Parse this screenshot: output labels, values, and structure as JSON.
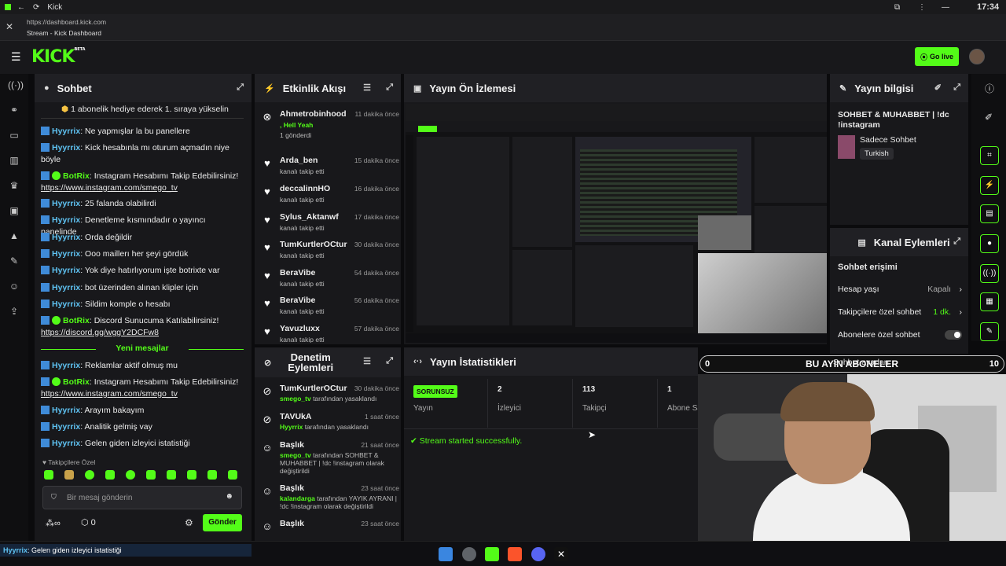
{
  "browser": {
    "tab_title": "Kick",
    "url": "https://dashboard.kick.com",
    "page_title": "Stream - Kick Dashboard",
    "clock": "17:34"
  },
  "app": {
    "logo": "KICK",
    "logo_tag": "BETA",
    "go_live": "Go live"
  },
  "chat": {
    "title": "Sohbet",
    "top_notice": "1 abonelik hediye ederek 1. sıraya yükselin",
    "messages": [
      {
        "user": "Hyyrrix",
        "text": "Ne yapmışlar la bu panellere"
      },
      {
        "user": "Hyyrrix",
        "text": "Kick hesabınla mı oturum açmadın niye böyle"
      },
      {
        "user": "BotRix",
        "text": "Instagram Hesabımı Takip Edebilirsiniz!",
        "link": "https://www.instagram.com/smego_tv"
      },
      {
        "user": "Hyyrrix",
        "text": "25 falanda olabilirdi"
      },
      {
        "user": "Hyyrrix",
        "text": "Denetleme kısmındadır o yayıncı panelinde"
      },
      {
        "user": "Hyyrrix",
        "text": "Orda değildir"
      },
      {
        "user": "Hyyrrix",
        "text": "Ooo maillerı her şeyi gördük"
      },
      {
        "user": "Hyyrrix",
        "text": "Yok diye hatırlıyorum işte botrixte var"
      },
      {
        "user": "Hyyrrix",
        "text": "bot üzerinden alınan klipler için"
      },
      {
        "user": "Hyyrrix",
        "text": "Sildim komple o hesabı"
      },
      {
        "user": "BotRix",
        "text": "Discord Sunucuma Katılabilirsiniz!",
        "link": "https://discord.gg/wggY2DCFw8"
      }
    ],
    "new_messages": "Yeni mesajlar",
    "messages2": [
      {
        "user": "Hyyrrix",
        "text": "Reklamlar aktif olmuş mu"
      },
      {
        "user": "BotRix",
        "text": "Instagram Hesabımı Takip Edebilirsiniz!",
        "link": "https://www.instagram.com/smego_tv"
      },
      {
        "user": "Hyyrrix",
        "text": "Arayım bakayım"
      },
      {
        "user": "Hyyrrix",
        "text": "Analitik gelmiş vay"
      },
      {
        "user": "Hyyrrix",
        "text": "Gelen giden izleyici istatistiği"
      }
    ],
    "followers_only": "Takipçilere Özel",
    "input_placeholder": "Bir mesaj gönderin",
    "count": "0",
    "send": "Gönder"
  },
  "activity": {
    "title": "Etkinlik Akışı",
    "items": [
      {
        "name": "Ahmetrobinhood",
        "extra": ", Hell Yeah",
        "sub": "1 gönderdi",
        "time": "11 dakika önce",
        "icon": "gift"
      },
      {
        "name": "Arda_ben",
        "sub": "kanalı takip etti",
        "time": "15 dakika önce",
        "icon": "heart"
      },
      {
        "name": "deccalinnHO",
        "sub": "kanalı takip etti",
        "time": "16 dakika önce",
        "icon": "heart"
      },
      {
        "name": "Sylus_Aktanwf",
        "sub": "kanalı takip etti",
        "time": "17 dakika önce",
        "icon": "heart"
      },
      {
        "name": "TumKurtlerOCtur",
        "sub": "kanalı takip etti",
        "time": "30 dakika önce",
        "icon": "heart"
      },
      {
        "name": "BeraVibe",
        "sub": "kanalı takip etti",
        "time": "54 dakika önce",
        "icon": "heart"
      },
      {
        "name": "BeraVibe",
        "sub": "kanalı takip etti",
        "time": "56 dakika önce",
        "icon": "heart"
      },
      {
        "name": "Yavuzluxx",
        "sub": "kanalı takip etti",
        "time": "57 dakika önce",
        "icon": "heart"
      }
    ]
  },
  "moderation": {
    "title": "Denetim Eylemleri",
    "items": [
      {
        "name": "TumKurtlerOCtur",
        "actor": "smego_tv",
        "text": "tarafından yasaklandı",
        "time": "30 dakika önce"
      },
      {
        "name": "TAVUkA",
        "actor": "Hyyrrix",
        "text": "tarafından yasaklandı",
        "time": "1 saat önce"
      },
      {
        "name": "Başlık",
        "actor": "smego_tv",
        "text": "tarafından SOHBET & MUHABBET | !dc !instagram olarak değiştirildi",
        "time": "21 saat önce"
      },
      {
        "name": "Başlık",
        "actor": "kalandarga",
        "text": "tarafından YAYIK AYRANI | !dc !instagram olarak değiştirildi",
        "time": "23 saat önce"
      },
      {
        "name": "Başlık",
        "actor": "",
        "text": "",
        "time": "23 saat önce"
      }
    ]
  },
  "preview": {
    "title": "Yayın Ön İzlemesi"
  },
  "stats": {
    "title": "Yayın İstatistikleri",
    "status": "SORUNSUZ",
    "status_label": "Yayın",
    "viewers": "2",
    "viewers_label": "İzleyici",
    "followers": "113",
    "followers_label": "Takipçi",
    "subs": "1",
    "subs_label": "Abone Sa",
    "message": "Stream started successfully."
  },
  "stream_info": {
    "title": "Yayın bilgisi",
    "stream_title": "SOHBET & MUHABBET | !dc !instagram",
    "category": "Sadece Sohbet",
    "language": "Turkish"
  },
  "channel_actions": {
    "title": "Kanal Eylemleri",
    "section": "Sohbet erişimi",
    "rows": [
      {
        "label": "Hesap yaşı",
        "value": "Kapalı"
      },
      {
        "label": "Takipçilere özel sohbet",
        "value": "1 dk."
      },
      {
        "label": "Abonelere özel sohbet",
        "value": ""
      }
    ],
    "cut_label": "Sohbet ayarları"
  },
  "overlay": {
    "banner": "BU AYIN ABONELER",
    "left_count": "0",
    "right_count": "10"
  },
  "toast": {
    "user": "Hyyrrix",
    "text": ": Gelen giden izleyici istatistiği"
  },
  "colors": {
    "accent": "#53fc18",
    "panel": "#18181b"
  }
}
